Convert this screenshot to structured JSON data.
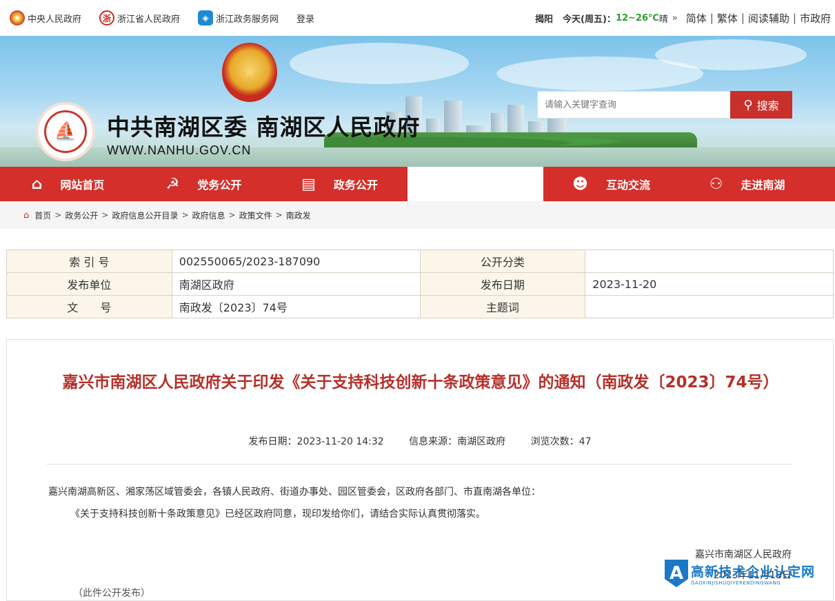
{
  "topbar": {
    "links": [
      {
        "label": "中央人民政府",
        "icon": "national-emblem-icon"
      },
      {
        "label": "浙江省人民政府",
        "icon": "zhejiang-gov-icon"
      },
      {
        "label": "浙江政务服务网",
        "icon": "zhejiang-service-icon"
      },
      {
        "label": "登录"
      }
    ],
    "weather": {
      "city": "揭阳",
      "day": "今天(周五)：",
      "temp": "12~26℃",
      "condition": "晴",
      "more": "»"
    },
    "tools": [
      "简体",
      "繁体",
      "阅读辅助",
      "市政府"
    ]
  },
  "banner": {
    "title": "中共南湖区委 南湖区人民政府",
    "url": "WWW.NANHU.GOV.CN",
    "search_placeholder": "请输入关键字查询",
    "search_button": "搜索"
  },
  "nav": [
    {
      "label": "网站首页",
      "icon": "home-icon"
    },
    {
      "label": "党务公开",
      "icon": "party-icon"
    },
    {
      "label": "政务公开",
      "icon": "gov-affairs-icon"
    },
    {
      "label": "",
      "icon": ""
    },
    {
      "label": "互动交流",
      "icon": "interaction-icon"
    },
    {
      "label": "走进南湖",
      "icon": "people-icon"
    }
  ],
  "breadcrumb": [
    "首页",
    "政务公开",
    "政府信息公开目录",
    "政府信息",
    "政策文件",
    "南政发"
  ],
  "meta": {
    "rows": [
      {
        "k1": "索 引 号",
        "v1": "002550065/2023-187090",
        "k2": "公开分类",
        "v2": ""
      },
      {
        "k1": "发布单位",
        "v1": "南湖区政府",
        "k2": "发布日期",
        "v2": "2023-11-20"
      },
      {
        "k1": "文　　号",
        "v1": "南政发〔2023〕74号",
        "k2": "主题词",
        "v2": ""
      }
    ]
  },
  "article": {
    "title": "嘉兴市南湖区人民政府关于印发《关于支持科技创新十条政策意见》的通知（南政发〔2023〕74号）",
    "publish": "发布日期：2023-11-20 14:32",
    "source": "信息来源：南湖区政府",
    "views": "浏览次数：47",
    "addressee": "嘉兴南湖高新区、湘家荡区域管委会，各镇人民政府、街道办事处、园区管委会，区政府各部门、市直南湖各单位：",
    "body": "《关于支持科技创新十条政策意见》已经区政府同意，现印发给你们，请结合实际认真贯彻落实。",
    "signature": "嘉兴市南湖区人民政府",
    "date": "2023年11月18日",
    "note": "（此件公开发布）"
  },
  "watermark": {
    "badge": "A",
    "big": "高新技术企业认定网",
    "small": "GAOXINJISHUQIYERENDINGWANG"
  }
}
